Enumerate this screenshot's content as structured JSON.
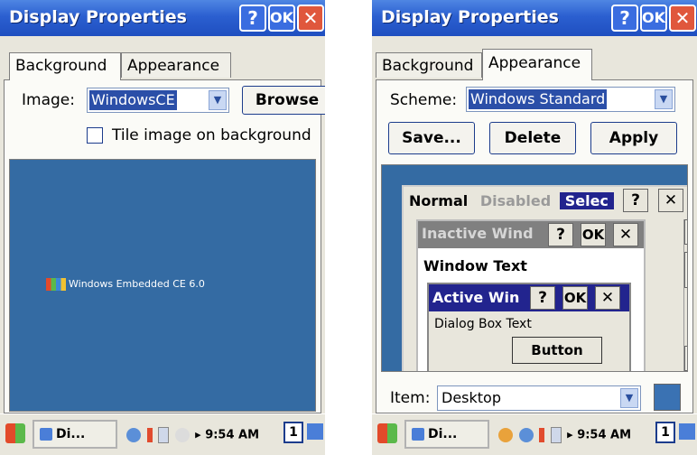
{
  "left": {
    "title": "Display Properties",
    "title_buttons": {
      "help": "?",
      "ok": "OK",
      "close": "✕"
    },
    "tabs": [
      {
        "label": "Background"
      },
      {
        "label": "Appearance"
      }
    ],
    "image_label": "Image:",
    "image_value": "WindowsCE",
    "browse_label": "Browse",
    "tile_label": "Tile image on background",
    "tile_checked": false,
    "wallpaper_text": "Windows Embedded CE 6.0",
    "taskbar": {
      "task_label": "Di...",
      "time": "9:54 AM",
      "num": "1"
    }
  },
  "right": {
    "title": "Display Properties",
    "title_buttons": {
      "help": "?",
      "ok": "OK",
      "close": "✕"
    },
    "tabs": [
      {
        "label": "Background"
      },
      {
        "label": "Appearance"
      }
    ],
    "scheme_label": "Scheme:",
    "scheme_value": "Windows Standard",
    "buttons": {
      "save": "Save...",
      "delete": "Delete",
      "apply": "Apply"
    },
    "preview": {
      "normal": "Normal",
      "disabled": "Disabled",
      "selected": "Selec",
      "inactive_window": "Inactive Wind",
      "window_text": "Window Text",
      "active_window": "Active Win",
      "dialog_text": "Dialog Box Text",
      "button": "Button",
      "help": "?",
      "ok": "OK",
      "close": "✕"
    },
    "item_label": "Item:",
    "item_value": "Desktop",
    "item_color": "#3a72b3",
    "taskbar": {
      "task_label": "Di...",
      "time": "9:54 AM",
      "num": "1"
    }
  },
  "colors": {
    "titlebar": "#2b5fd0",
    "desktop": "#346ba3",
    "selection": "#2b4fa8",
    "close": "#e0573c"
  }
}
